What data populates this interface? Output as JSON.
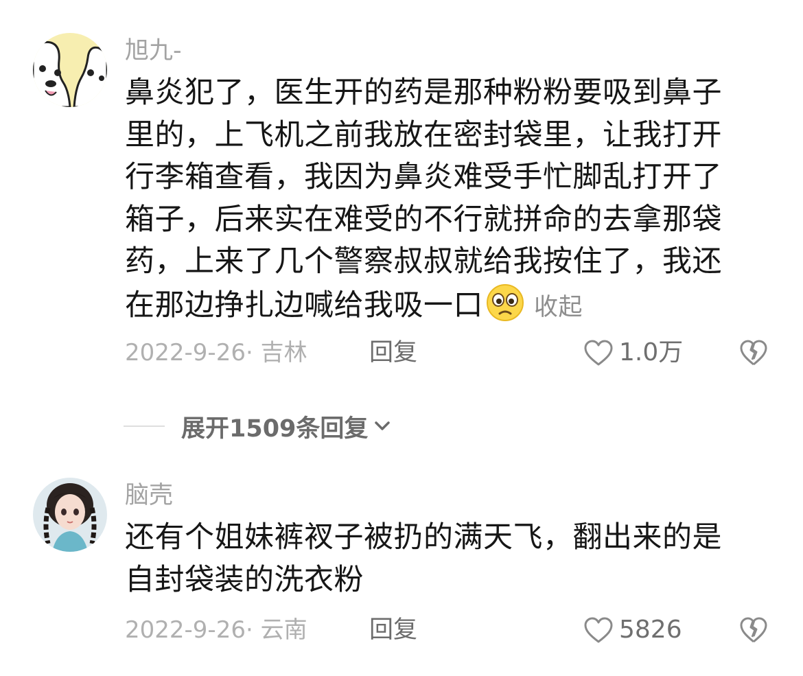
{
  "comments": [
    {
      "username": "旭九-",
      "avatar": "cartoon-dog-avatar",
      "lines": [
        "鼻炎犯了，医生开的药是那种粉粉要吸到鼻子",
        "里的，上飞机之前我放在密封袋里，让我打开",
        "行李箱查看，我因为鼻炎难受手忙脚乱打开了",
        "箱子，后来实在难受的不行就拼命的去拿那袋",
        "药，上来了几个警察叔叔就给我按住了，我还",
        "在那边挣扎边喊给我吸一口"
      ],
      "emoji": "worried-face-emoji",
      "collapse_label": "收起",
      "date_location": "2022-9-26· 吉林",
      "reply_label": "回复",
      "like_count": "1.0万"
    },
    {
      "username": "脑壳",
      "avatar": "anime-girl-avatar",
      "lines": [
        "还有个姐妹裤衩子被扔的满天飞，翻出来的是",
        "自封袋装的洗衣粉"
      ],
      "date_location": "2022-9-26· 云南",
      "reply_label": "回复",
      "like_count": "5826"
    }
  ],
  "expand_replies": {
    "label": "展开1509条回复",
    "icon": "chevron-down-icon"
  },
  "colors": {
    "username": "#a3a3a3",
    "body": "#161616",
    "meta": "#b0b0b0",
    "action": "#6c6c6c"
  }
}
